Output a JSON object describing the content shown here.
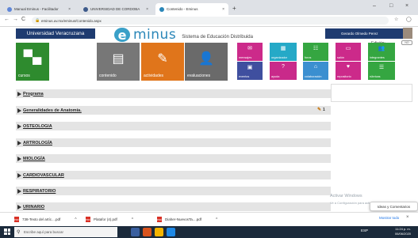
{
  "browser": {
    "tabs": [
      {
        "label": "Manual Eminus - Facilitador",
        "color": "#5f86d8"
      },
      {
        "label": "UNIVERSIDAD DE CORDOBA",
        "color": "#3d5a8a"
      },
      {
        "label": "Contenido - Eminus",
        "color": "#2a86b8"
      }
    ],
    "url": "eminus.uv.mx/eminus/Contenido.aspx",
    "new_tab": "+",
    "window_controls": [
      "–",
      "□",
      "×"
    ]
  },
  "header": {
    "university": "Universidad Veracruzana",
    "logo_e": "e",
    "logo_rest": "minus",
    "subtitle": "Sistema de Educación Distribuida",
    "user": "Gerardo Olmedo Perez",
    "edicion_label": "Edición:",
    "edicion_toggle": "NO"
  },
  "big_tiles": [
    {
      "label": "cursos",
      "color": "#2e8b2e",
      "icon": "presentation-icon"
    },
    {
      "label": "contenido",
      "color": "#777777",
      "icon": "book-icon"
    },
    {
      "label": "actividades",
      "color": "#e0751b",
      "icon": "edit-icon"
    },
    {
      "label": "evaluaciones",
      "color": "#6a6a6a",
      "icon": "user-check-icon"
    }
  ],
  "small_tiles": [
    {
      "label": "mensajes",
      "color": "#cc2a8a",
      "icon": "envelope-icon"
    },
    {
      "label": "organizador",
      "color": "#25a9c7",
      "icon": "calendar-icon"
    },
    {
      "label": "foros",
      "color": "#35a641",
      "icon": "forum-icon"
    },
    {
      "label": "salón",
      "color": "#cc2a8a",
      "icon": "classroom-icon"
    },
    {
      "label": "integrantes",
      "color": "#35a641",
      "icon": "group-icon"
    },
    {
      "label": "eventos",
      "color": "#3f4f9f",
      "icon": "event-icon"
    },
    {
      "label": "ayuda",
      "color": "#c92a8a",
      "icon": "help-icon"
    },
    {
      "label": "colaboración",
      "color": "#3b8fd0",
      "icon": "collab-icon"
    },
    {
      "label": "repositorio",
      "color": "#cc2a8a",
      "icon": "repository-icon"
    },
    {
      "label": "rúbricas",
      "color": "#35a641",
      "icon": "rubric-icon"
    }
  ],
  "content_rows": [
    {
      "label": "Programa",
      "badge": ""
    },
    {
      "label": "Generalidades de Anatomía.",
      "badge": "1"
    },
    {
      "label": "OSTEOLOGIA",
      "badge": ""
    },
    {
      "label": "ARTROLOGÍA",
      "badge": ""
    },
    {
      "label": "MIOLOGÍA",
      "badge": ""
    },
    {
      "label": "CARDIOVASCULAR",
      "badge": ""
    },
    {
      "label": "RESPIRATORIO",
      "badge": ""
    },
    {
      "label": "URINARIO",
      "badge": ""
    }
  ],
  "overlay": {
    "activate_windows": "Activar Windows",
    "activate_sub": "Ve a Configuración para activar Windows.",
    "ideas": "Ideas y Comentarios"
  },
  "downloads": [
    {
      "name": "738-Texto del artíc....pdf"
    },
    {
      "name": "Platafor (4).pdf"
    },
    {
      "name": "Diaher-NuevosTa....pdf"
    }
  ],
  "downloads_show_all": "Mostrar todo",
  "taskbar": {
    "search_placeholder": "Escribe aquí para buscar",
    "tray_lang": "ESP",
    "time": "11:24 p. m.",
    "date": "06/06/2020"
  }
}
